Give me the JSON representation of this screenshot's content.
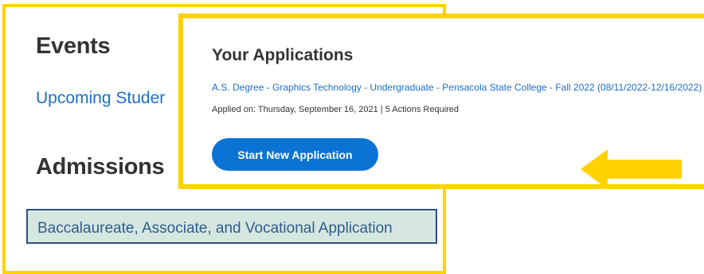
{
  "events": {
    "heading": "Events",
    "upcoming_link": "Upcoming Studer"
  },
  "admissions": {
    "heading": "Admissions",
    "application_type": "Baccalaureate, Associate, and Vocational Application"
  },
  "applications": {
    "title": "Your Applications",
    "item": {
      "link": "A.S. Degree - Graphics Technology - Undergraduate - Pensacola State College - Fall 2022 (08/11/2022-12/16/2022)",
      "meta": "Applied on: Thursday, September 16, 2021 | 5 Actions Required"
    },
    "start_button": "Start New Application"
  },
  "colors": {
    "highlight_border": "#ffd200",
    "arrow": "#ffd200",
    "button": "#0b73d4",
    "link": "#1a6fc9"
  },
  "icons": {
    "arrow": "left-arrow-icon"
  }
}
